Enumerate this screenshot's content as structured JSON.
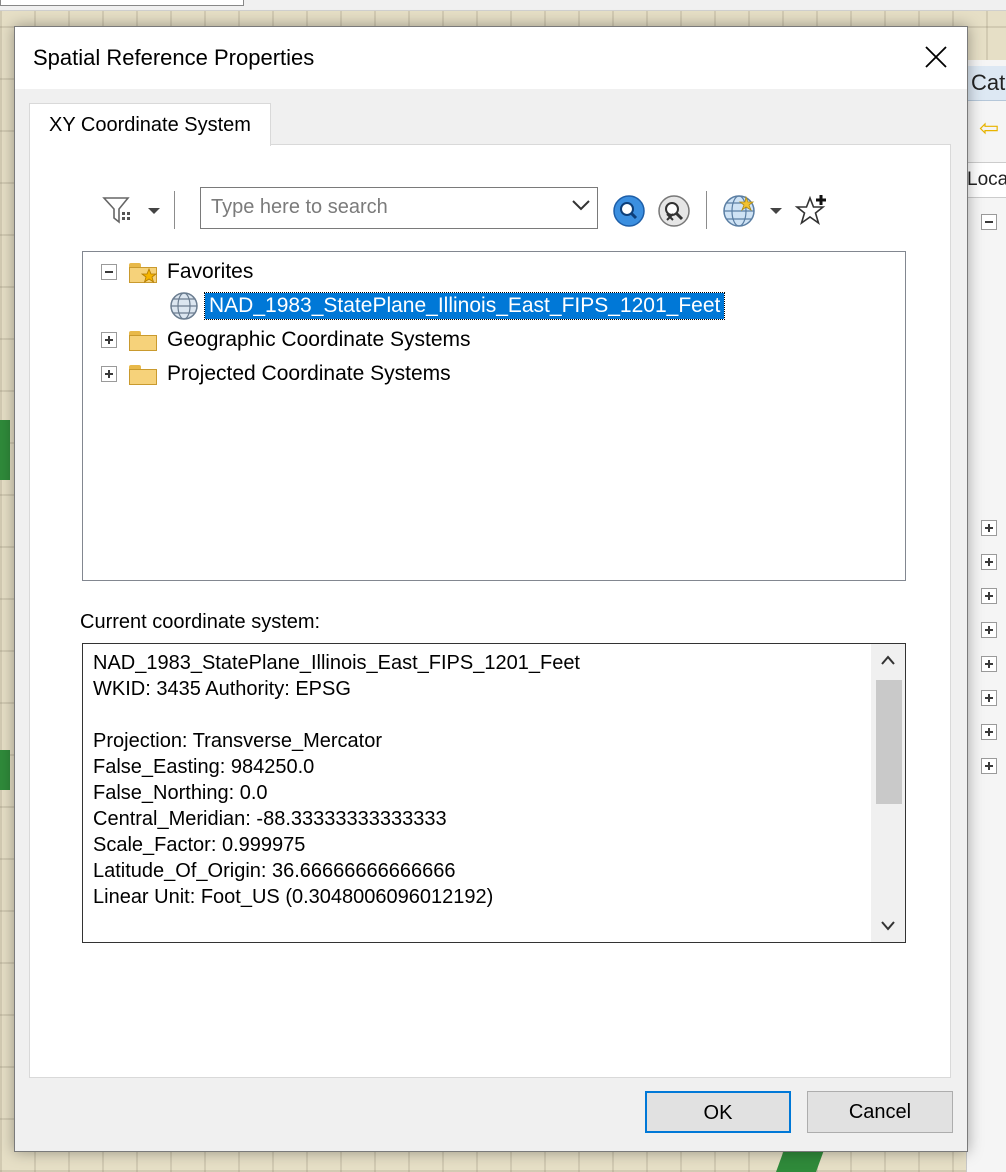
{
  "dialog": {
    "title": "Spatial Reference Properties",
    "close_glyph": "✕"
  },
  "tabs": [
    {
      "label": "XY Coordinate System",
      "selected": true
    }
  ],
  "toolbar": {
    "search_placeholder": "Type here to search",
    "icons": [
      "filter-icon",
      "dropdown-arrow-icon",
      "search-icon",
      "clear-search-icon",
      "globe-icon",
      "add-favorite-icon"
    ]
  },
  "tree": {
    "favorites_label": "Favorites",
    "favorite_item": "NAD_1983_StatePlane_Illinois_East_FIPS_1201_Feet",
    "geographic_label": "Geographic Coordinate Systems",
    "projected_label": "Projected Coordinate Systems"
  },
  "current": {
    "label": "Current coordinate system:",
    "text": "NAD_1983_StatePlane_Illinois_East_FIPS_1201_Feet\nWKID: 3435 Authority: EPSG\n\nProjection: Transverse_Mercator\nFalse_Easting: 984250.0\nFalse_Northing: 0.0\nCentral_Meridian: -88.33333333333333\nScale_Factor: 0.999975\nLatitude_Of_Origin: 36.66666666666666\nLinear Unit: Foot_US (0.3048006096012192)"
  },
  "buttons": {
    "ok": "OK",
    "cancel": "Cancel"
  },
  "catalog": {
    "tab_label": "Cat",
    "location_label": "Loca"
  },
  "colors": {
    "selection": "#0078d7",
    "folder": "#f6d27a",
    "dialog_bg": "#f0f0f0"
  }
}
